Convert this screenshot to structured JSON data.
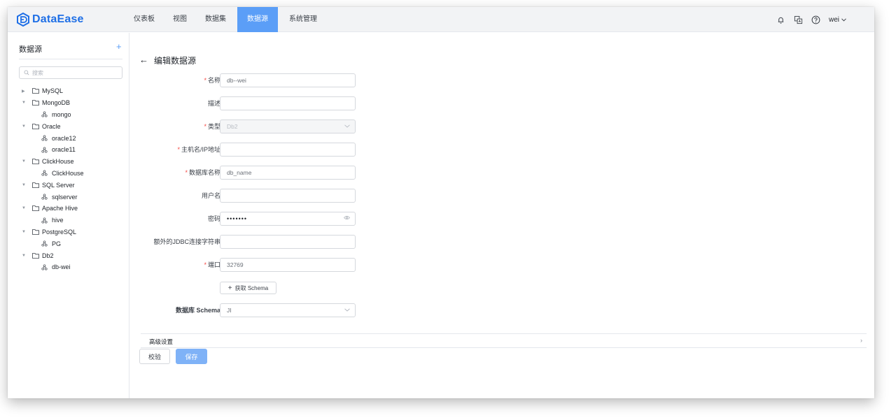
{
  "app": {
    "name": "DataEase",
    "brand_color": "#1f6fe6",
    "accent": "#5b9ef7"
  },
  "nav": {
    "items": [
      {
        "label": "仪表板"
      },
      {
        "label": "视图"
      },
      {
        "label": "数据集"
      },
      {
        "label": "数据源",
        "active": true
      },
      {
        "label": "系统管理"
      }
    ]
  },
  "header_right": {
    "icons": [
      "bell-icon",
      "translate-icon",
      "help-icon"
    ],
    "user": "wei"
  },
  "sidebar": {
    "title": "数据源",
    "add": "+",
    "search_placeholder": "搜索",
    "tree": [
      {
        "type": "folder",
        "label": "MySQL",
        "expanded": false
      },
      {
        "type": "folder",
        "label": "MongoDB",
        "expanded": true
      },
      {
        "type": "source",
        "label": "mongo"
      },
      {
        "type": "folder",
        "label": "Oracle",
        "expanded": true
      },
      {
        "type": "source",
        "label": "oracle12"
      },
      {
        "type": "source",
        "label": "oracle11"
      },
      {
        "type": "folder",
        "label": "ClickHouse",
        "expanded": true
      },
      {
        "type": "source",
        "label": "ClickHouse"
      },
      {
        "type": "folder",
        "label": "SQL Server",
        "expanded": true
      },
      {
        "type": "source",
        "label": "sqlserver"
      },
      {
        "type": "folder",
        "label": "Apache Hive",
        "expanded": true
      },
      {
        "type": "source",
        "label": "hive"
      },
      {
        "type": "folder",
        "label": "PostgreSQL",
        "expanded": true
      },
      {
        "type": "source",
        "label": "PG"
      },
      {
        "type": "folder",
        "label": "Db2",
        "expanded": true
      },
      {
        "type": "source",
        "label": "db-wei"
      }
    ]
  },
  "form": {
    "back": "←",
    "title": "编辑数据源",
    "fields": {
      "name": {
        "label": "名称",
        "required": true,
        "value": "db--wei"
      },
      "desc": {
        "label": "描述",
        "required": false,
        "value": ""
      },
      "type": {
        "label": "类型",
        "required": true,
        "value": "Db2"
      },
      "host": {
        "label": "主机名/IP地址",
        "required": true,
        "value": ""
      },
      "dbname": {
        "label": "数据库名称",
        "required": true,
        "value": "db_name"
      },
      "user": {
        "label": "用户名",
        "required": false,
        "value": ""
      },
      "password": {
        "label": "密码",
        "required": false,
        "value": "•••••••"
      },
      "jdbc": {
        "label": "额外的JDBC连接字符串",
        "required": false,
        "value": ""
      },
      "port": {
        "label": "端口",
        "required": true,
        "value": "32769"
      },
      "schema": {
        "label": "数据库 Schema",
        "required": false,
        "value": "JI"
      }
    },
    "get_schema": "获取 Schema",
    "advanced": "高级设置",
    "validate": "校验",
    "save": "保存"
  }
}
